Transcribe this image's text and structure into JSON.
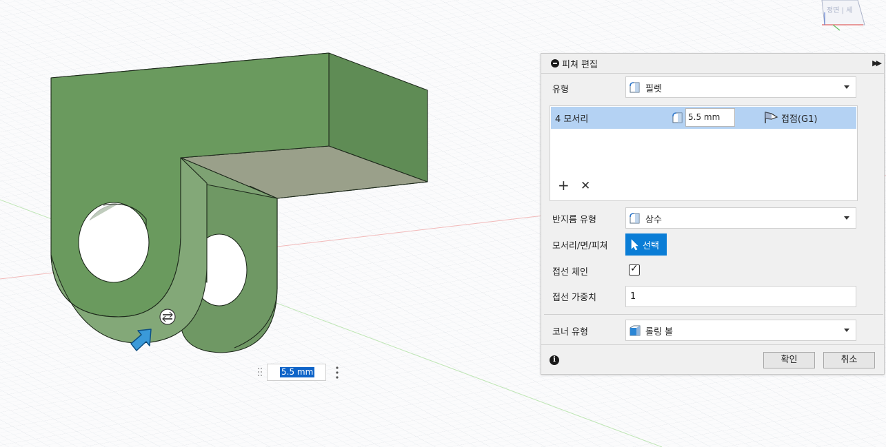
{
  "panel": {
    "title": "피쳐 편집",
    "type_label": "유형",
    "type_value": "필렛",
    "edges": {
      "count_label": "4 모서리",
      "radius": "5.5 mm",
      "continuity": "접점(G1)"
    },
    "radius_type_label": "반지름 유형",
    "radius_type_value": "상수",
    "selection_label": "모서리/면/피쳐",
    "select_button": "선택",
    "tangent_chain_label": "접선 체인",
    "tangent_chain_checked": true,
    "tangent_weight_label": "접선 가중치",
    "tangent_weight_value": "1",
    "corner_type_label": "코너 유형",
    "corner_type_value": "롤링 볼",
    "ok_button": "확인",
    "cancel_button": "취소"
  },
  "canvas": {
    "dimension_value": "5.5 mm",
    "viewcube_label": "정면 | 세"
  },
  "colors": {
    "model_green": "#6a9a5e",
    "selection_blue": "#b4d2f3",
    "accent_blue": "#0a7dd6"
  },
  "icons": {
    "collapse": "collapse-minus-icon",
    "expand": "double-chevron-right-icon",
    "fillet": "fillet-icon",
    "continuity": "tangent-flag-icon",
    "add": "plus-icon",
    "remove": "close-icon",
    "select": "cursor-arrow-icon",
    "corner": "rolling-ball-icon",
    "info": "info-icon",
    "manipulator": "drag-arrow-icon",
    "rotate_handle": "rotate-handle-icon"
  }
}
